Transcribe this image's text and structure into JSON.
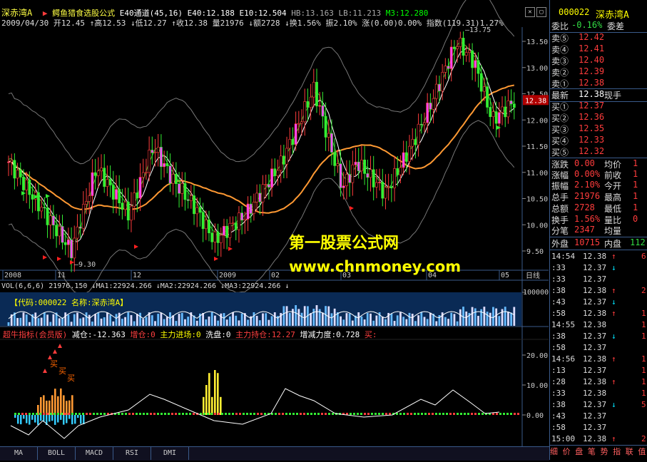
{
  "main_header": {
    "stock": "深赤湾A",
    "formula": "鳄鱼猎食选股公式",
    "indicators": [
      {
        "label": "E40通道(45,16)",
        "color": "#ffffff"
      },
      {
        "label": "E40:12.188",
        "color": "#ffffff"
      },
      {
        "label": "E10:12.504",
        "color": "#ffffff"
      },
      {
        "label": "HB:13.163",
        "color": "#aaaaaa"
      },
      {
        "label": "LB:11.213",
        "color": "#aaaaaa"
      },
      {
        "label": "M3:12.280",
        "color": "#00ff00"
      }
    ],
    "info_line": "2009/04/30 开12.45 ↑高12.53 ↓低12.27 ↑收12.38 量21976 ↓额2728 ↓换1.56% 振2.10% 涨(0.00)0.00% 指数(119.31)1.27%"
  },
  "price_axis": [
    "13.50",
    "13.00",
    "12.50",
    "12.00",
    "11.50",
    "11.00",
    "10.50",
    "10.00",
    "9.50"
  ],
  "price_marker": "12.38",
  "chart_annotations": {
    "high": "13.75",
    "low": "9.30",
    "watermark_title": "第一股票公式网",
    "watermark_url": "www.chnmoney.com"
  },
  "time_axis": [
    "2008",
    "11",
    "12",
    "2009",
    "02",
    "03",
    "04",
    "05"
  ],
  "period_label": "日线",
  "volume": {
    "header": "VOL(6,6,6) 21976.150 ↓MA1:22924.266 ↓MA2:22924.266 ↓MA3:22924.266 ↓",
    "code_label": "【代码:000022 名称:深赤湾A】",
    "axis_label": "100000"
  },
  "indicator_panel": {
    "header_title": "超牛指标(会员版)",
    "items": [
      {
        "label": "减仓:-12.363",
        "color": "#ffffff"
      },
      {
        "label": "增仓:0",
        "color": "#ff4040"
      },
      {
        "label": "主力进场:0",
        "color": "#ffff00"
      },
      {
        "label": "洗盘:0",
        "color": "#ffffff"
      },
      {
        "label": "主力持仓:12.27",
        "color": "#ff4040"
      },
      {
        "label": "增减力度:0.728",
        "color": "#ffffff"
      },
      {
        "label": "买:",
        "color": "#ff4040"
      }
    ],
    "axis": [
      "20.00",
      "10.00",
      "0.00"
    ],
    "buy_marks": [
      "买",
      "买",
      "买"
    ]
  },
  "bottom_tabs": [
    "MA",
    "BOLL",
    "MACD",
    "RSI",
    "DMI"
  ],
  "quote": {
    "code": "000022",
    "name": "深赤湾A",
    "weibi_label": "委比",
    "weibi_value": "-0.16%",
    "weicha_label": "委差",
    "sell": [
      {
        "label": "卖⑤",
        "price": "12.42"
      },
      {
        "label": "卖④",
        "price": "12.41"
      },
      {
        "label": "卖③",
        "price": "12.40"
      },
      {
        "label": "卖②",
        "price": "12.39"
      },
      {
        "label": "卖①",
        "price": "12.38"
      }
    ],
    "latest_label": "最新",
    "latest_price": "12.38",
    "xianshou_label": "现手",
    "buy": [
      {
        "label": "买①",
        "price": "12.37"
      },
      {
        "label": "买②",
        "price": "12.36"
      },
      {
        "label": "买③",
        "price": "12.35"
      },
      {
        "label": "买④",
        "price": "12.33"
      },
      {
        "label": "买⑤",
        "price": "12.32"
      }
    ],
    "stats": [
      {
        "l1": "涨跌",
        "v1": "0.00",
        "l2": "均价",
        "v2": "1"
      },
      {
        "l1": "涨幅",
        "v1": "0.00%",
        "l2": "前收",
        "v2": "1"
      },
      {
        "l1": "振幅",
        "v1": "2.10%",
        "l2": "今开",
        "v2": "1"
      },
      {
        "l1": "总手",
        "v1": "21976",
        "l2": "最高",
        "v2": "1"
      },
      {
        "l1": "总额",
        "v1": "2728",
        "l2": "最低",
        "v2": "1"
      },
      {
        "l1": "换手",
        "v1": "1.56%",
        "l2": "量比",
        "v2": "0"
      },
      {
        "l1": "分笔",
        "v1": "2347",
        "l2": "均量",
        "v2": ""
      }
    ],
    "outer_label": "外盘",
    "outer_value": "10715",
    "inner_label": "内盘",
    "inner_value": "112",
    "ticks": [
      {
        "time": "14:54",
        "price": "12.38",
        "arrow": "↑",
        "vol": "6"
      },
      {
        "time": ":33",
        "price": "12.37",
        "arrow": "↓",
        "vol": ""
      },
      {
        "time": ":33",
        "price": "12.37",
        "arrow": "",
        "vol": ""
      },
      {
        "time": ":38",
        "price": "12.38",
        "arrow": "↑",
        "vol": "2"
      },
      {
        "time": ":43",
        "price": "12.37",
        "arrow": "↓",
        "vol": ""
      },
      {
        "time": ":58",
        "price": "12.38",
        "arrow": "↑",
        "vol": "1"
      },
      {
        "time": "14:55",
        "price": "12.38",
        "arrow": "",
        "vol": "1"
      },
      {
        "time": ":38",
        "price": "12.37",
        "arrow": "↓",
        "vol": "1"
      },
      {
        "time": ":58",
        "price": "12.37",
        "arrow": "",
        "vol": ""
      },
      {
        "time": "14:56",
        "price": "12.38",
        "arrow": "↑",
        "vol": "1"
      },
      {
        "time": ":13",
        "price": "12.37",
        "arrow": "",
        "vol": "1"
      },
      {
        "time": ":28",
        "price": "12.38",
        "arrow": "↑",
        "vol": "1"
      },
      {
        "time": ":33",
        "price": "12.38",
        "arrow": "",
        "vol": "1"
      },
      {
        "time": ":38",
        "price": "12.37",
        "arrow": "↓",
        "vol": "5"
      },
      {
        "time": ":43",
        "price": "12.37",
        "arrow": "",
        "vol": ""
      },
      {
        "time": ":58",
        "price": "12.37",
        "arrow": "",
        "vol": ""
      },
      {
        "time": "15:00",
        "price": "12.38",
        "arrow": "↑",
        "vol": "2"
      }
    ],
    "bottom_menu": "细 价 盘 笔 势 指 联 值 筹 资 讯"
  }
}
